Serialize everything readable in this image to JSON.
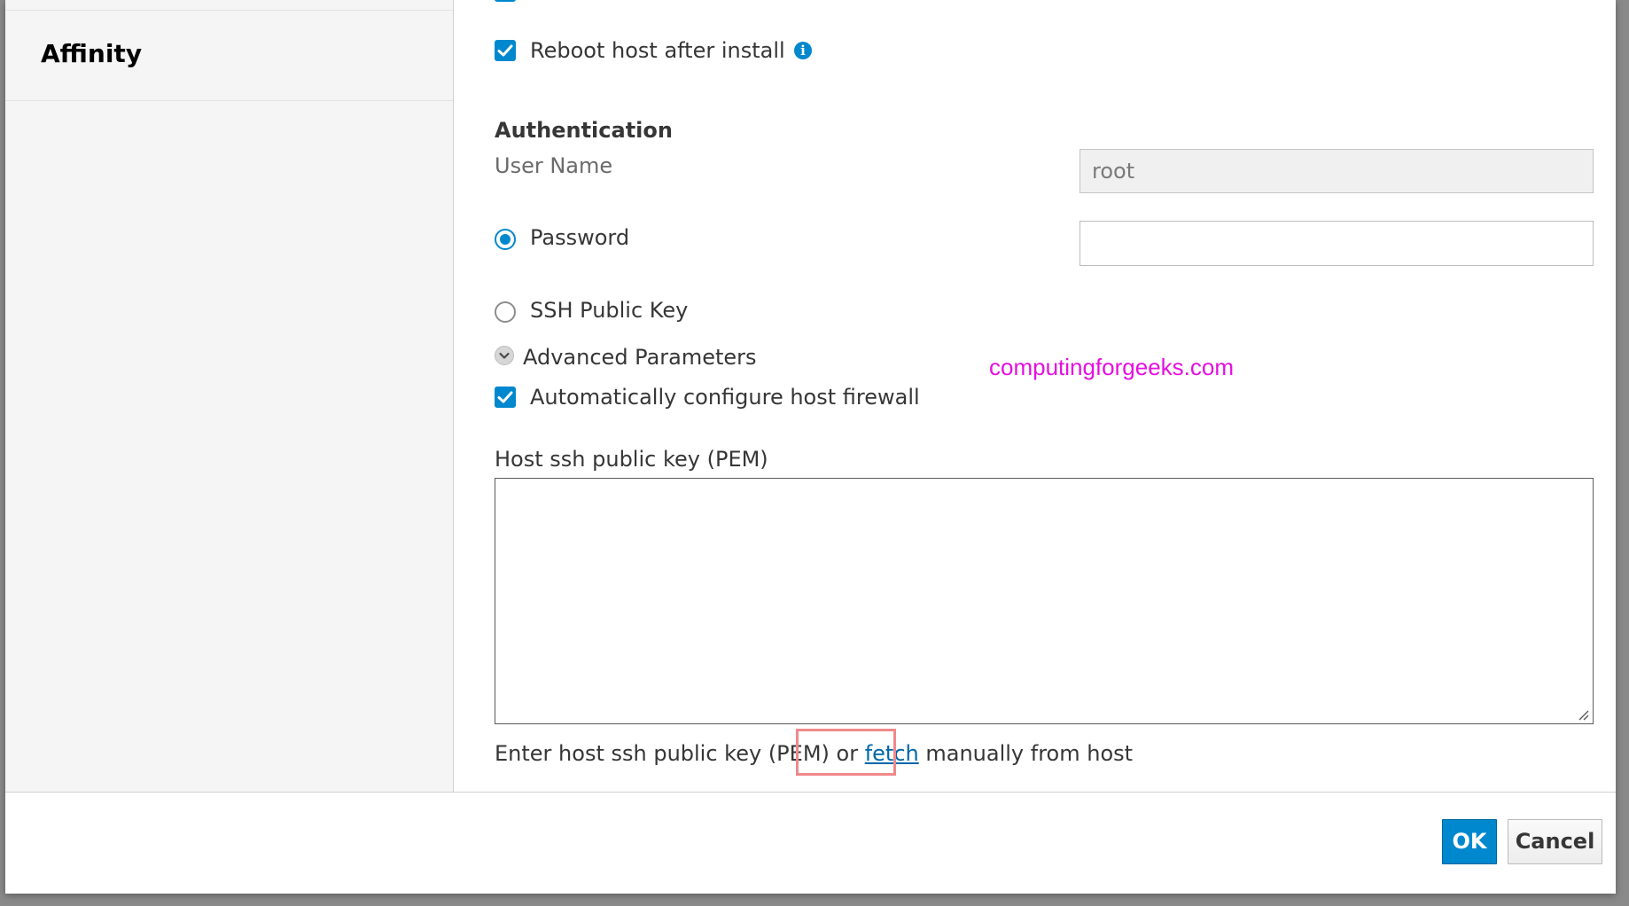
{
  "sidebar": {
    "items": [
      {
        "label": "Affinity"
      }
    ]
  },
  "main": {
    "reboot_checkbox": {
      "label": "Reboot host after install",
      "checked": true
    },
    "authentication": {
      "heading": "Authentication",
      "user_name_label": "User Name",
      "user_name_value": "root",
      "password_option": {
        "label": "Password",
        "selected": true
      },
      "password_value": "",
      "ssh_key_option": {
        "label": "SSH Public Key",
        "selected": false
      }
    },
    "advanced": {
      "label": "Advanced Parameters",
      "firewall_checkbox": {
        "label": "Automatically configure host firewall",
        "checked": true
      }
    },
    "watermark": "computingforgeeks.com",
    "host_key": {
      "label": "Host ssh public key (PEM)",
      "value": "",
      "help_before": "Enter host ssh public key (PEM) or ",
      "help_link": "fetch",
      "help_after": " manually from host"
    }
  },
  "footer": {
    "ok_label": "OK",
    "cancel_label": "Cancel"
  },
  "colors": {
    "accent": "#0088ce",
    "watermark": "#e60fe0",
    "highlight": "#f0898b",
    "link": "#0066aa"
  },
  "icons": [
    "checkmark-icon",
    "info-icon",
    "chevron-down-icon",
    "resize-grip-icon"
  ]
}
